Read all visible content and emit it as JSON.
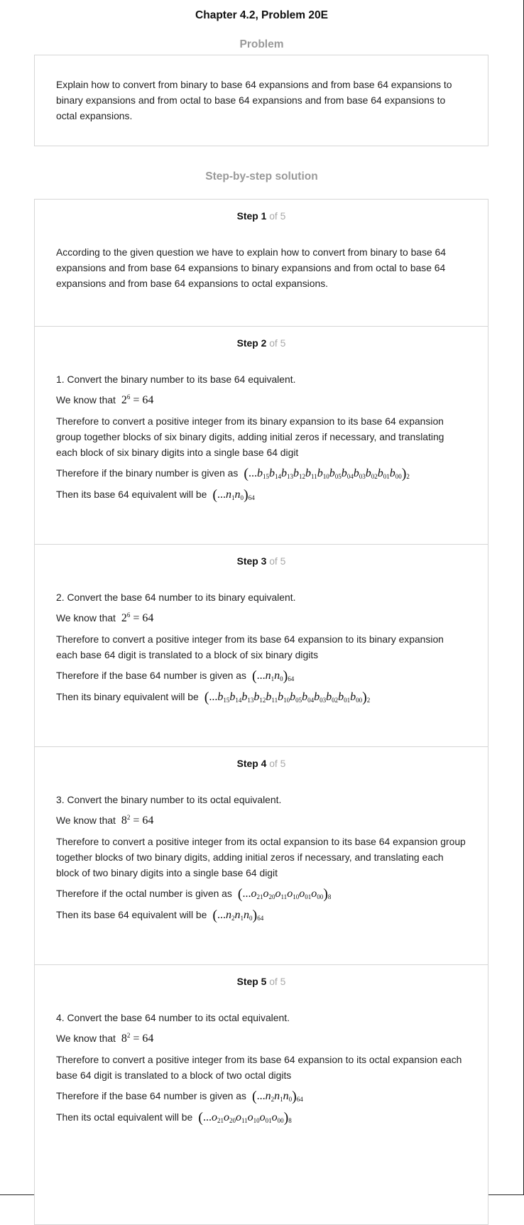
{
  "header": {
    "title": "Chapter 4.2, Problem 20E"
  },
  "problem": {
    "heading": "Problem",
    "text": "Explain how to convert from binary to base 64 expansions and from base 64 expansions to binary expansions and from octal to base 64 expansions and from base 64 expansions to octal expansions."
  },
  "solution": {
    "heading": "Step-by-step solution",
    "step_word": "Step",
    "of_text": "of 5",
    "steps": [
      {
        "number": "1",
        "text": "According to the given question we have to explain how to convert from binary to base 64 expansions and from base 64 expansions to binary expansions and from octal to base 64 expansions and from base 64 expansions to octal expansions."
      },
      {
        "number": "2",
        "intro": "1. Convert the binary number to its base 64 equivalent.",
        "know": "We know that",
        "explain": "Therefore to convert a positive integer from its binary expansion to its base 64 expansion group together blocks of six binary digits, adding initial zeros if necessary, and translating each block of six binary digits into a single base 64 digit",
        "given": "Therefore if the binary number is given as",
        "then": "Then its base 64 equivalent will be"
      },
      {
        "number": "3",
        "intro": "2. Convert the base 64 number to its binary equivalent.",
        "know": "We know that",
        "explain": "Therefore to convert a positive integer from its base 64 expansion to its binary expansion each base 64 digit is translated to a block of six binary digits",
        "given": "Therefore if the base 64 number is given as",
        "then": "Then its binary equivalent will be"
      },
      {
        "number": "4",
        "intro": "3. Convert the binary number to its octal equivalent.",
        "know": "We know that",
        "explain": "Therefore to convert a positive integer from its octal expansion to its base 64 expansion group together blocks of two binary digits, adding initial zeros if necessary, and translating each block of two binary digits into a single base 64 digit",
        "given": "Therefore if the octal number is given as",
        "then": "Then its base 64 equivalent will be"
      },
      {
        "number": "5",
        "intro": "4. Convert the base 64 number to its octal equivalent.",
        "know": "We know that",
        "explain": "Therefore to convert a positive integer from its base 64 expansion to its octal expansion each base 64 digit is translated to a block of two octal digits",
        "given": "Therefore if the base 64 number is given as",
        "then": "Then its octal equivalent will be"
      }
    ]
  }
}
